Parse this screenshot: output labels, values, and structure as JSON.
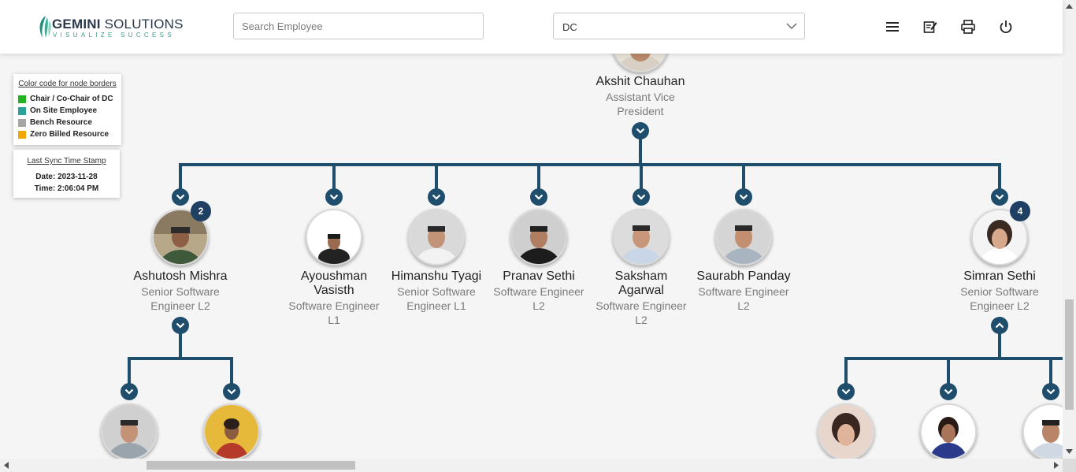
{
  "header": {
    "logo": {
      "brand": "GEMINI",
      "brand_rest": "SOLUTIONS",
      "tagline": "VISUALIZE SUCCESS"
    },
    "search": {
      "placeholder": "Search Employee"
    },
    "dc_select": {
      "value": "DC"
    },
    "icons": [
      "menu-icon",
      "report-icon",
      "print-icon",
      "power-icon"
    ]
  },
  "legend": {
    "title": "Color code for node borders",
    "items": [
      {
        "label": "Chair / Co-Chair of DC",
        "color": "#22b322"
      },
      {
        "label": "On Site Employee",
        "color": "#2aa198"
      },
      {
        "label": "Bench Resource",
        "color": "#a6a6a6"
      },
      {
        "label": "Zero Billed Resource",
        "color": "#f0a800"
      }
    ]
  },
  "sync": {
    "title": "Last Sync Time Stamp",
    "date": "Date: 2023-11-28",
    "time": "Time: 2:06:04 PM"
  },
  "tree": {
    "line_color": "#1f4e6d",
    "root": {
      "name": "Akshit Chauhan",
      "title_line1": "Assistant Vice",
      "title_line2": "President"
    },
    "children": [
      {
        "name": "Ashutosh Mishra",
        "name_line2": "",
        "title_line1": "Senior Software",
        "title_line2": "Engineer L2",
        "badge": "2"
      },
      {
        "name": "Ayoushman",
        "name_line2": "Vasisth",
        "title_line1": "Software Engineer",
        "title_line2": "L1",
        "badge": ""
      },
      {
        "name": "Himanshu Tyagi",
        "name_line2": "",
        "title_line1": "Senior Software",
        "title_line2": "Engineer L1",
        "badge": ""
      },
      {
        "name": "Pranav Sethi",
        "name_line2": "",
        "title_line1": "Software Engineer",
        "title_line2": "L2",
        "badge": ""
      },
      {
        "name": "Saksham",
        "name_line2": "Agarwal",
        "title_line1": "Software Engineer",
        "title_line2": "L2",
        "badge": ""
      },
      {
        "name": "Saurabh Panday",
        "name_line2": "",
        "title_line1": "Software Engineer",
        "title_line2": "L2",
        "badge": ""
      },
      {
        "name": "Simran Sethi",
        "name_line2": "",
        "title_line1": "Senior Software",
        "title_line2": "Engineer L2",
        "badge": "4"
      }
    ]
  }
}
